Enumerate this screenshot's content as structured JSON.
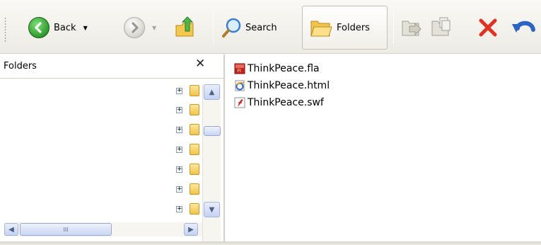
{
  "toolbar": {
    "back_label": "Back",
    "search_label": "Search",
    "folders_label": "Folders"
  },
  "folder_pane": {
    "title": "Folders",
    "close_glyph": "✕",
    "expander_glyph": "+",
    "scroll_up": "▲",
    "scroll_down": "▼",
    "scroll_left": "◀",
    "scroll_right": "▶",
    "hthumb_grip": "III"
  },
  "files": [
    {
      "name": "ThinkPeace.fla",
      "icon": "flash-fla-icon"
    },
    {
      "name": "ThinkPeace.html",
      "icon": "ie-html-icon"
    },
    {
      "name": "ThinkPeace.swf",
      "icon": "flash-swf-icon"
    }
  ],
  "colors": {
    "delete_red": "#e3301f",
    "undo_blue": "#2a64c4"
  }
}
